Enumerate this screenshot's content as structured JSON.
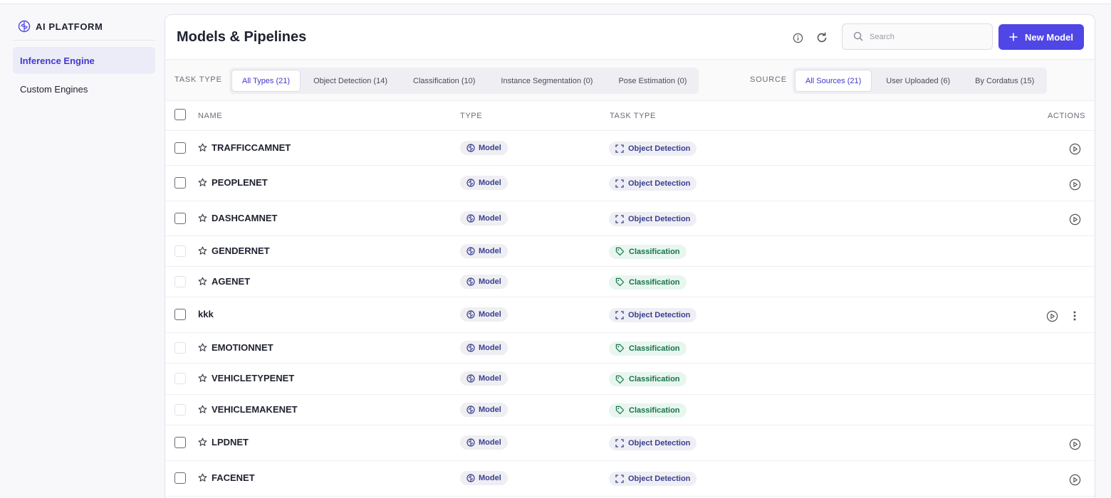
{
  "brand": {
    "name": "AI PLATFORM"
  },
  "sidebar": {
    "items": [
      {
        "label": "Inference Engine",
        "active": true
      },
      {
        "label": "Custom Engines",
        "active": false
      }
    ]
  },
  "header": {
    "title": "Models & Pipelines",
    "search_placeholder": "Search",
    "new_button_label": "New Model"
  },
  "filters": {
    "task_type_label": "TASK TYPE",
    "task_types": [
      {
        "label": "All Types (21)",
        "active": true
      },
      {
        "label": "Object Detection (14)",
        "active": false
      },
      {
        "label": "Classification (10)",
        "active": false
      },
      {
        "label": "Instance Segmentation (0)",
        "active": false
      },
      {
        "label": "Pose Estimation (0)",
        "active": false
      }
    ],
    "source_label": "SOURCE",
    "sources": [
      {
        "label": "All Sources (21)",
        "active": true
      },
      {
        "label": "User Uploaded (6)",
        "active": false
      },
      {
        "label": "By Cordatus (15)",
        "active": false
      }
    ]
  },
  "table": {
    "columns": {
      "name": "NAME",
      "type": "TYPE",
      "task_type": "TASK TYPE",
      "actions": "ACTIONS"
    },
    "rows": [
      {
        "name": "TRAFFICCAMNET",
        "type": "Model",
        "task": "Object Detection"
      },
      {
        "name": "PEOPLENET",
        "type": "Model",
        "task": "Object Detection"
      },
      {
        "name": "DASHCAMNET",
        "type": "Model",
        "task": "Object Detection"
      },
      {
        "name": "GENDERNET",
        "type": "Model",
        "task": "Classification"
      },
      {
        "name": "AGENET",
        "type": "Model",
        "task": "Classification"
      },
      {
        "name": "kkk",
        "type": "Model",
        "task": "Object Detection"
      },
      {
        "name": "EMOTIONNET",
        "type": "Model",
        "task": "Classification"
      },
      {
        "name": "VEHICLETYPENET",
        "type": "Model",
        "task": "Classification"
      },
      {
        "name": "VEHICLEMAKENET",
        "type": "Model",
        "task": "Classification"
      },
      {
        "name": "LPDNET",
        "type": "Model",
        "task": "Object Detection"
      },
      {
        "name": "FACENET",
        "type": "Model",
        "task": "Object Detection"
      }
    ]
  },
  "colors": {
    "accent": "#4f46e5",
    "classification": "#17744a",
    "detection": "#3a3f8c"
  }
}
